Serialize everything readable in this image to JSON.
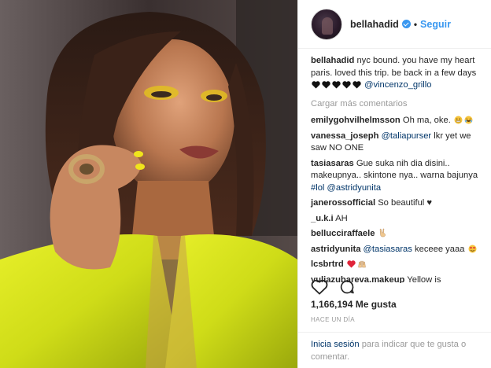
{
  "photo": {
    "alt_subject": "woman in yellow blazer"
  },
  "header": {
    "username": "bellahadid",
    "separator": "•",
    "follow_label": "Seguir"
  },
  "caption": {
    "username": "bellahadid",
    "text": "nyc bound. you have my heart paris. loved this trip. be back in a few days",
    "mention": "@vincenzo_grillo"
  },
  "load_more_label": "Cargar más comentarios",
  "comments": [
    {
      "user": "emilygohvilhelmsson",
      "text": "Oh ma, oke."
    },
    {
      "user": "vanessa_joseph",
      "mention": "@taliapurser",
      "text": "lkr yet we saw NO ONE"
    },
    {
      "user": "tasiasaras",
      "text": "Gue suka nih dia disini.. makeupnya.. skintone nya.. warna bajunya",
      "tag": "#lol",
      "mention": "@astridyunita"
    },
    {
      "user": "janerossofficial",
      "text": "So beautiful ♥"
    },
    {
      "user": "_u.k.i",
      "text": "AH"
    },
    {
      "user": "bellucciraffaele",
      "text": ""
    },
    {
      "user": "astridyunita",
      "mention": "@tasiasaras",
      "text": "keceee yaaa"
    },
    {
      "user": "lcsbrtrd",
      "text": ""
    },
    {
      "user": "yuliazubareva.makeup",
      "text": "Yellow is"
    }
  ],
  "likes": {
    "text": "1,166,194 Me gusta"
  },
  "time": {
    "text": "HACE UN DÍA"
  },
  "login": {
    "link": "Inicia sesión",
    "rest": "para indicar que te gusta o comentar."
  },
  "colors": {
    "accent": "#3897f0",
    "link": "#003569",
    "muted": "#999999",
    "blazer": "#d7e61c"
  },
  "icons": [
    "heart-icon",
    "comment-icon",
    "verified-badge-icon"
  ]
}
